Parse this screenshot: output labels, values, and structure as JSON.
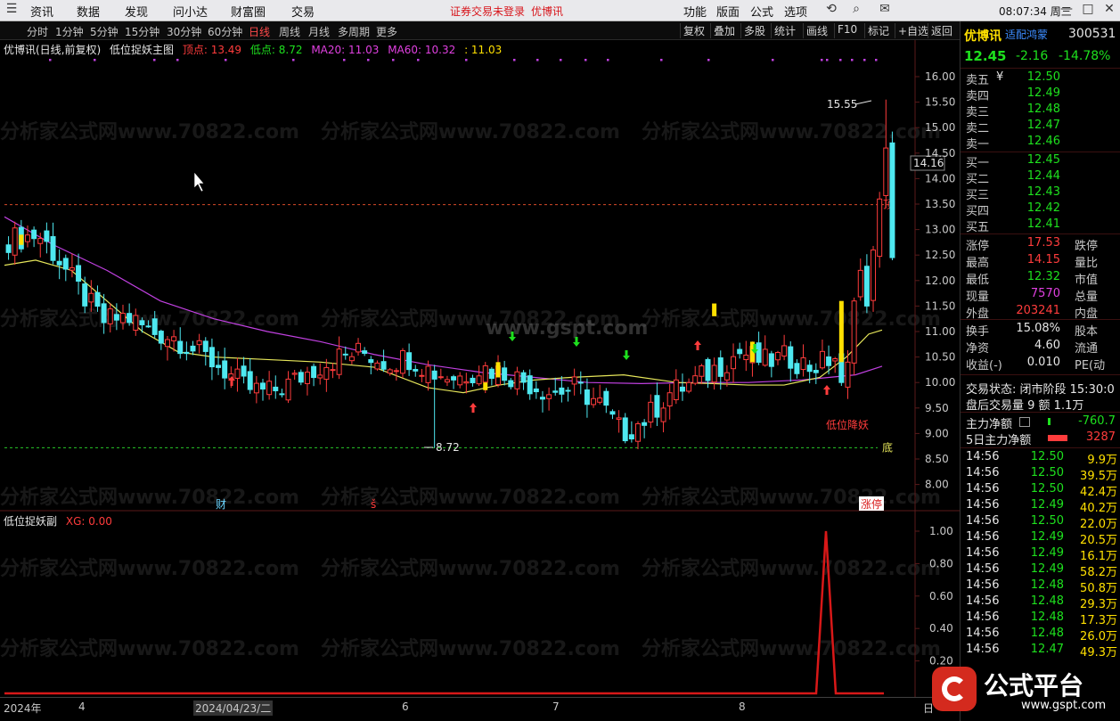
{
  "menu": {
    "items": [
      "分时",
      "资讯",
      "数据",
      "发现",
      "问小达",
      "财富圈",
      "交易"
    ],
    "warning": "证券交易未登录",
    "stock_name": "优博讯",
    "right_items": [
      "功能",
      "版面",
      "公式",
      "选项"
    ],
    "clock": "08:07:34 周三"
  },
  "periods": {
    "items": [
      "分时",
      "1分钟",
      "5分钟",
      "15分钟",
      "30分钟",
      "60分钟",
      "日线",
      "周线",
      "月线",
      "多周期",
      "更多"
    ],
    "active": "日线",
    "tools": [
      "复权",
      "叠加",
      "多股",
      "统计",
      "画线",
      "F10",
      "标记",
      "+自选",
      "返回"
    ]
  },
  "main_legend": {
    "title": "优博讯(日线,前复权)",
    "indicator": "低位捉妖主图",
    "top_label": "顶点: 13.49",
    "low_label": "低点: 8.72",
    "ma20_label": "MA20: 11.03",
    "ma60_label": "MA60: 10.32",
    "extra_label": ": 11.03"
  },
  "sub_legend": {
    "indicator": "低位捉妖副",
    "xg_label": "XG: 0.00"
  },
  "price_axis": [
    "16.00",
    "15.50",
    "15.00",
    "14.50",
    "14.00",
    "13.50",
    "13.00",
    "12.50",
    "12.00",
    "11.50",
    "11.00",
    "10.50",
    "10.00",
    "9.50",
    "9.00",
    "8.50",
    "8.00"
  ],
  "sub_axis": [
    "1.00",
    "0.80",
    "0.60",
    "0.40",
    "0.20"
  ],
  "cursor_price": "14.16",
  "annotations": {
    "high": "15.55",
    "low": "8.72",
    "top_mark": "顶",
    "bottom_mark": "底",
    "signal_text": "低位降妖",
    "cai_mark": "财",
    "zhangting_mark": "涨停",
    "other_mark": "š"
  },
  "time_axis": {
    "labels": [
      "2024年",
      "4",
      "2024/04/23/二",
      "6",
      "7",
      "8"
    ],
    "end_label": "日"
  },
  "quote": {
    "name": "优博讯",
    "tag": "适配鸿蒙",
    "code": "300531",
    "price": "12.45",
    "change": "-2.16",
    "change_pct": "-14.78%",
    "asks": [
      {
        "label": "卖五",
        "price": "12.50",
        "mark": "¥"
      },
      {
        "label": "卖四",
        "price": "12.49"
      },
      {
        "label": "卖三",
        "price": "12.48"
      },
      {
        "label": "卖二",
        "price": "12.47"
      },
      {
        "label": "卖一",
        "price": "12.46"
      }
    ],
    "bids": [
      {
        "label": "买一",
        "price": "12.45"
      },
      {
        "label": "买二",
        "price": "12.44"
      },
      {
        "label": "买三",
        "price": "12.43"
      },
      {
        "label": "买四",
        "price": "12.42"
      },
      {
        "label": "买五",
        "price": "12.41"
      }
    ],
    "stats": [
      {
        "l1": "涨停",
        "v1": "17.53",
        "l2": "跌停"
      },
      {
        "l1": "最高",
        "v1": "14.15",
        "l2": "量比"
      },
      {
        "l1": "最低",
        "v1": "12.32",
        "l2": "市值"
      },
      {
        "l1": "现量",
        "v1": "7570",
        "l2": "总量"
      },
      {
        "l1": "外盘",
        "v1": "203241",
        "l2": "内盘"
      }
    ],
    "stats2": [
      {
        "l1": "换手",
        "v1": "15.08%",
        "l2": "股本"
      },
      {
        "l1": "净资",
        "v1": "4.60",
        "l2": "流通"
      },
      {
        "l1": "收益(-)",
        "v1": "0.010",
        "l2": "PE(动"
      }
    ],
    "trade_status": "交易状态: 闭市阶段 15:30:0",
    "after_hours": "盘后交易量 9 额 1.1万",
    "main_net_label": "主力净额",
    "main_net_value": "-760.7",
    "main_net5_label": "5日主力净额",
    "main_net5_value": "3287"
  },
  "ticks": [
    {
      "time": "14:56",
      "price": "12.50",
      "vol": "9.9万"
    },
    {
      "time": "14:56",
      "price": "12.50",
      "vol": "39.5万"
    },
    {
      "time": "14:56",
      "price": "12.50",
      "vol": "42.4万"
    },
    {
      "time": "14:56",
      "price": "12.49",
      "vol": "40.2万"
    },
    {
      "time": "14:56",
      "price": "12.50",
      "vol": "22.0万"
    },
    {
      "time": "14:56",
      "price": "12.49",
      "vol": "20.5万"
    },
    {
      "time": "14:56",
      "price": "12.49",
      "vol": "16.1万"
    },
    {
      "time": "14:56",
      "price": "12.49",
      "vol": "58.2万"
    },
    {
      "time": "14:56",
      "price": "12.48",
      "vol": "50.8万"
    },
    {
      "time": "14:56",
      "price": "12.48",
      "vol": "29.3万"
    },
    {
      "time": "14:56",
      "price": "12.48",
      "vol": "17.3万"
    },
    {
      "time": "14:56",
      "price": "12.48",
      "vol": "26.0万"
    },
    {
      "time": "14:56",
      "price": "12.47",
      "vol": "49.3万"
    }
  ],
  "watermarks": {
    "main": "分析家公式网www.70822.com",
    "site": "www.gspt.com",
    "logo_text": "公式平台",
    "logo_url": "www.gspt.com"
  },
  "colors": {
    "up": "#ff3c3c",
    "down": "#4ee8f0",
    "ma20": "#e6e65a",
    "ma60": "#c040e0",
    "signal": "#ffe000",
    "xg_line": "#d81818"
  },
  "chart_data": {
    "type": "candlestick",
    "price_range": [
      8.0,
      16.0
    ],
    "top_level": 13.49,
    "low_level": 8.72,
    "high_marker": 15.55,
    "sub_indicator_range": [
      0,
      1.0
    ],
    "xg_peak": 1.0
  }
}
